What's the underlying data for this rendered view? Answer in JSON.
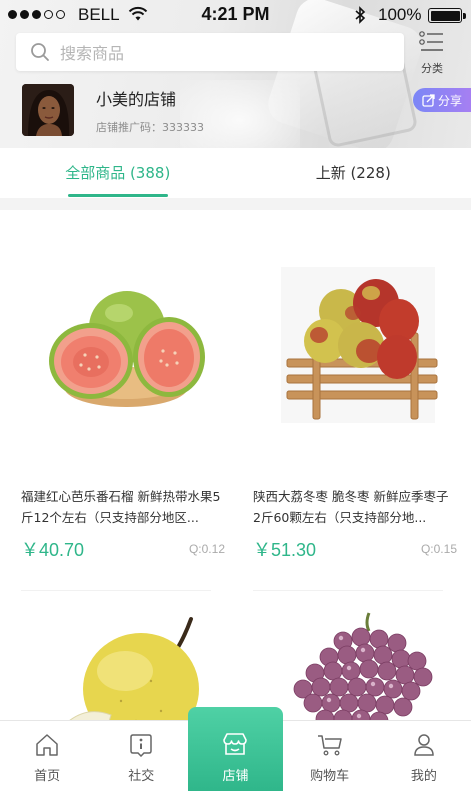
{
  "status_bar": {
    "carrier": "BELL",
    "time": "4:21 PM",
    "battery": "100%",
    "signal_bars_filled": 3,
    "signal_bars_total": 5
  },
  "search": {
    "placeholder": "搜索商品"
  },
  "category_button": {
    "label": "分类",
    "icon": "list-icon"
  },
  "shop": {
    "name": "小美的店铺",
    "promo_code_label": "店铺推广码：",
    "promo_code": "333333"
  },
  "share_button": {
    "label": "分享",
    "icon": "share-icon"
  },
  "tabs": [
    {
      "label": "全部商品 (388)",
      "active": true
    },
    {
      "label": "上新 (228)",
      "active": false
    }
  ],
  "products": [
    {
      "title": "福建红心芭乐番石榴 新鲜热带水果5斤12个左右（只支持部分地区...",
      "price": "￥40.70",
      "qty": "Q:0.12",
      "image": "guava-image"
    },
    {
      "title": "陕西大荔冬枣 脆冬枣 新鲜应季枣子2斤60颗左右（只支持部分地...",
      "price": "￥51.30",
      "qty": "Q:0.15",
      "image": "winter-jujube-image"
    },
    {
      "title": "",
      "price": "",
      "qty": "",
      "image": "pear-image"
    },
    {
      "title": "",
      "price": "",
      "qty": "",
      "image": "grapes-image"
    }
  ],
  "bottom_nav": [
    {
      "label": "首页",
      "icon": "home-icon",
      "active": false
    },
    {
      "label": "社交",
      "icon": "info-icon",
      "active": false
    },
    {
      "label": "店铺",
      "icon": "store-icon",
      "active": true
    },
    {
      "label": "购物车",
      "icon": "cart-icon",
      "active": false
    },
    {
      "label": "我的",
      "icon": "user-icon",
      "active": false
    }
  ],
  "colors": {
    "accent": "#2fb68a",
    "share_gradient_start": "#7b87f6",
    "share_gradient_end": "#a67ff2",
    "price": "#2fb68a"
  }
}
